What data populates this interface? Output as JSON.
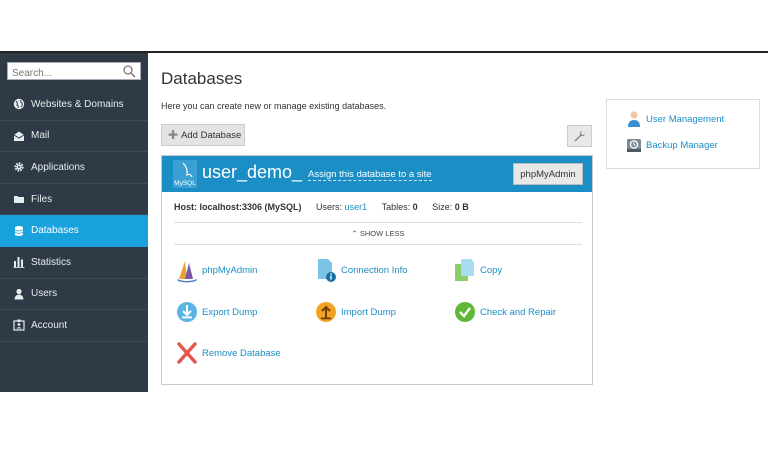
{
  "search": {
    "placeholder": "Search..."
  },
  "sidebar": {
    "items": [
      {
        "label": "Websites & Domains",
        "icon": "globe-icon"
      },
      {
        "label": "Mail",
        "icon": "envelope-icon"
      },
      {
        "label": "Applications",
        "icon": "gear-icon"
      },
      {
        "label": "Files",
        "icon": "folder-icon"
      },
      {
        "label": "Databases",
        "icon": "database-icon",
        "active": true
      },
      {
        "label": "Statistics",
        "icon": "bar-chart-icon"
      },
      {
        "label": "Users",
        "icon": "user-icon"
      },
      {
        "label": "Account",
        "icon": "id-card-icon"
      }
    ]
  },
  "main": {
    "title": "Databases",
    "description": "Here you can create new or manage existing databases.",
    "add_button": "Add Database"
  },
  "db": {
    "logo_text": "MySQL",
    "name": "user_demo_",
    "assign_link": "Assign this database to a site",
    "phpmyadmin_button": "phpMyAdmin",
    "host_label": "Host: localhost:3306 (MySQL)",
    "users_label": "Users:",
    "users_value": "user1",
    "tables_label": "Tables:",
    "tables_value": "0",
    "size_label": "Size:",
    "size_value": "0 B",
    "show_less": "SHOW LESS",
    "actions": {
      "phpmyadmin": "phpMyAdmin",
      "connection_info": "Connection Info",
      "copy": "Copy",
      "export_dump": "Export Dump",
      "import_dump": "Import Dump",
      "check_repair": "Check and Repair",
      "remove": "Remove Database"
    }
  },
  "side_box": {
    "user_management": "User Management",
    "backup_manager": "Backup Manager"
  },
  "colors": {
    "sidebar_bg": "#2e3a45",
    "active_nav": "#19a1dc",
    "db_header": "#1a8ec5",
    "link": "#1a8ec5"
  }
}
